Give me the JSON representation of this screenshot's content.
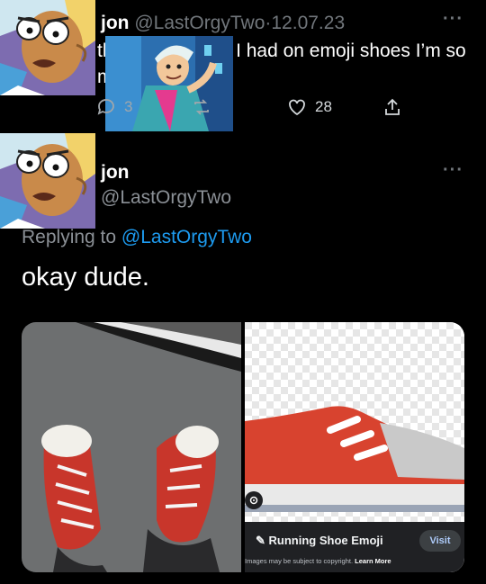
{
  "tweet1": {
    "display_name": "jon",
    "handle": "@LastOrgyTwo",
    "separator": "·",
    "date": "12.07.23",
    "text": "this kid just said I had on emoji shoes I’m so mad",
    "reply_count": "3",
    "like_count": "28",
    "more_label": "···"
  },
  "tweet2": {
    "display_name": "jon",
    "handle": "@LastOrgyTwo",
    "replying_prefix": "Replying to",
    "replying_handle": "@LastOrgyTwo",
    "text": "okay dude.",
    "more_label": "···"
  },
  "image_result": {
    "title": "Running Shoe Emoji",
    "visit_label": "Visit",
    "copyright_text": "Images may be subject to copyright.",
    "learn_more": "Learn More"
  },
  "colors": {
    "background": "#000000",
    "link": "#1d9bf0",
    "muted": "#71767b",
    "shoe_red": "#d8432f"
  },
  "icons": [
    "reply-icon",
    "retweet-icon",
    "heart-icon",
    "share-icon",
    "lens-icon",
    "pencil-icon"
  ]
}
